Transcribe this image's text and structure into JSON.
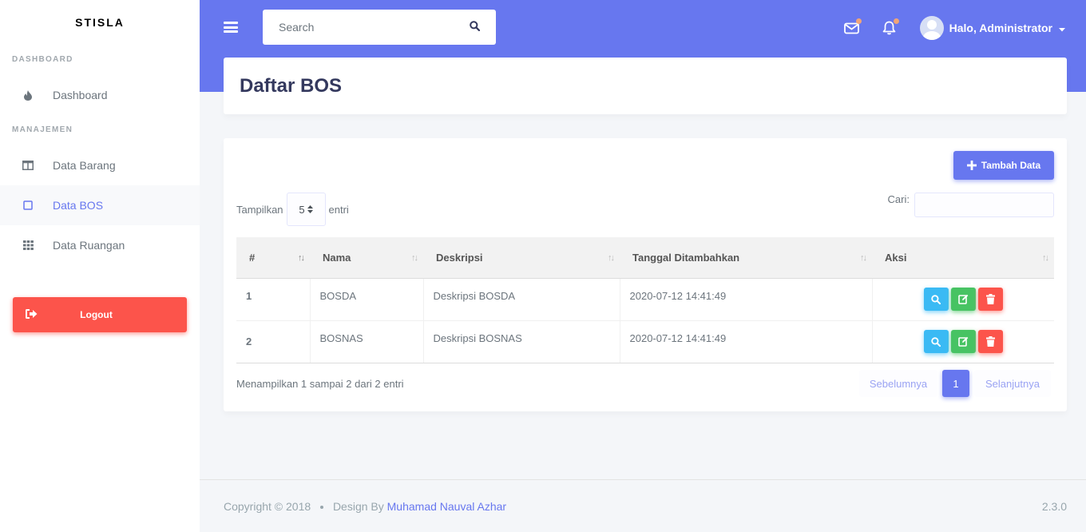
{
  "sidebar": {
    "brand": "STISLA",
    "sections": [
      {
        "header": "DASHBOARD"
      },
      {
        "header": "MANAJEMEN"
      }
    ],
    "items": [
      {
        "label": "Dashboard",
        "icon": "fire-icon"
      },
      {
        "label": "Data Barang",
        "icon": "columns-icon"
      },
      {
        "label": "Data BOS",
        "icon": "square-icon",
        "active": true
      },
      {
        "label": "Data Ruangan",
        "icon": "grid-icon"
      }
    ],
    "logout_label": "Logout"
  },
  "navbar": {
    "search_placeholder": "Search",
    "user_label": "Halo, Administrator"
  },
  "page_title": "Daftar BOS",
  "card": {
    "add_button": "Tambah Data",
    "length_prefix": "Tampilkan",
    "length_value": "5",
    "length_suffix": "entri",
    "search_label": "Cari:",
    "columns": [
      "#",
      "Nama",
      "Deskripsi",
      "Tanggal Ditambahkan",
      "Aksi"
    ],
    "rows": [
      {
        "no": "1",
        "nama": "BOSDA",
        "deskripsi": "Deskripsi BOSDA",
        "tanggal": "2020-07-12 14:41:49"
      },
      {
        "no": "2",
        "nama": "BOSNAS",
        "deskripsi": "Deskripsi BOSNAS",
        "tanggal": "2020-07-12 14:41:49"
      }
    ],
    "info": "Menampilkan 1 sampai 2 dari 2 entri",
    "pagination": {
      "prev": "Sebelumnya",
      "current": "1",
      "next": "Selanjutnya"
    }
  },
  "footer": {
    "copyright": "Copyright © 2018",
    "design_by": "Design By",
    "author": "Muhamad Nauval Azhar",
    "version": "2.3.0"
  },
  "colors": {
    "primary": "#6777ef",
    "danger": "#fc544b",
    "info": "#3abaf4",
    "success": "#47c363"
  }
}
